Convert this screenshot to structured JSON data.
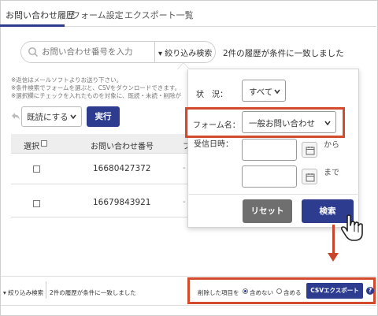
{
  "tabs": [
    {
      "label": "お問い合わせ履歴"
    },
    {
      "label": "フォーム設定"
    },
    {
      "label": "エクスポート一覧"
    }
  ],
  "search": {
    "placeholder": "お問い合わせ番号を入力",
    "filter_toggle": "▾ 絞り込み検索",
    "result_text": "2件の履歴が条件に一致しました"
  },
  "notes": [
    "※返信はメールソフトよりお送り下さい。",
    "※条件検索でフォームを選ぶと、CSVをダウンロードできます。",
    "※選択欄にチェックを入れたものを対象に、既読・未読・削除が"
  ],
  "actions": {
    "select_value": "既読にする",
    "run_label": "実行"
  },
  "table": {
    "headers": [
      "選択",
      "お問い合わせ番号",
      "フ"
    ],
    "rows": [
      {
        "number": "16680427372",
        "dash": "-"
      },
      {
        "number": "16679843921",
        "dash": "-"
      }
    ]
  },
  "filter_panel": {
    "status_label": "状　況：",
    "status_value": "すべて",
    "form_label": "フォーム名：",
    "form_value": "一般お問い合わせ",
    "date_label": "受信日時：",
    "from_label": "から",
    "to_label": "まで",
    "reset_label": "リセット",
    "search_label": "検索"
  },
  "bottom_bar": {
    "filter_toggle": "▾ 絞り込み検索",
    "result_text": "2件の履歴が条件に一致しました",
    "export_label": "削除した項目を",
    "radio_exclude": "含めない",
    "radio_include": "含める",
    "csv_label": "CSVエクスポート",
    "help": "?"
  },
  "colors": {
    "accent": "#2d3c8f",
    "highlight": "#d34a2c"
  }
}
